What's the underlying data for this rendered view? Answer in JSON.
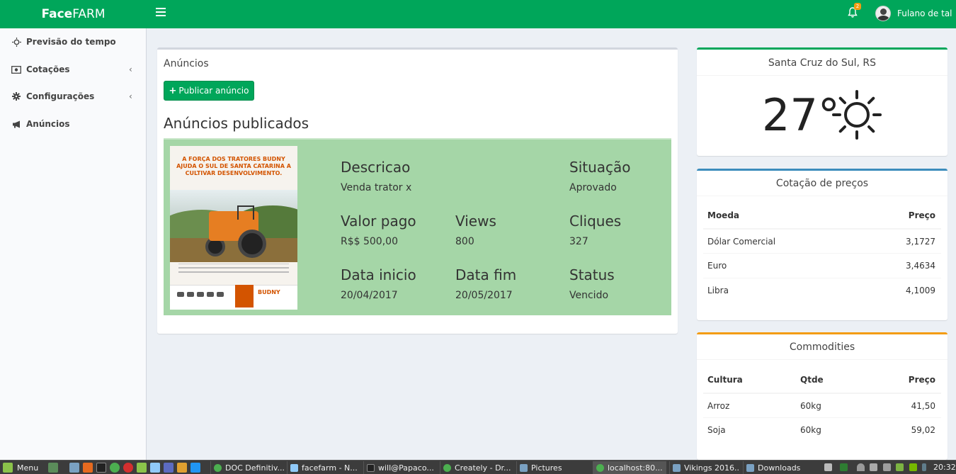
{
  "app": {
    "brand_bold": "Face",
    "brand_rest": "FARM"
  },
  "header": {
    "notification_count": "2",
    "user_name": "Fulano de tal"
  },
  "sidebar": {
    "items": [
      {
        "label": "Previsão do tempo",
        "icon": "sun-icon",
        "has_chevron": false
      },
      {
        "label": "Cotações",
        "icon": "money-icon",
        "has_chevron": true
      },
      {
        "label": "Configurações",
        "icon": "gear-icon",
        "has_chevron": true
      },
      {
        "label": "Anúncios",
        "icon": "bullhorn-icon",
        "has_chevron": false
      }
    ],
    "chevron_glyph": "‹"
  },
  "main": {
    "box_title": "Anúncios",
    "publish_button": "Publicar anúncio",
    "published_title": "Anúncios publicados",
    "ad": {
      "image_headline": "A FORÇA DOS TRATORES BUDNY AJUDA O SUL DE SANTA CATARINA A CULTIVAR DESENVOLVIMENTO.",
      "image_brand": "BUDNY",
      "fields": {
        "descricao": {
          "label": "Descricao",
          "value": "Venda trator x"
        },
        "situacao": {
          "label": "Situação",
          "value": "Aprovado"
        },
        "valor_pago": {
          "label": "Valor pago",
          "value": "R$$ 500,00"
        },
        "views": {
          "label": "Views",
          "value": "800"
        },
        "cliques": {
          "label": "Cliques",
          "value": "327"
        },
        "data_inicio": {
          "label": "Data inicio",
          "value": "20/04/2017"
        },
        "data_fim": {
          "label": "Data fim",
          "value": "20/05/2017"
        },
        "status": {
          "label": "Status",
          "value": "Vencido"
        }
      }
    }
  },
  "weather": {
    "city": "Santa Cruz do Sul, RS",
    "temperature": "27°",
    "icon": "sun-icon"
  },
  "rates": {
    "title": "Cotação de preços",
    "headers": [
      "Moeda",
      "Preço"
    ],
    "rows": [
      [
        "Dólar Comercial",
        "3,1727"
      ],
      [
        "Euro",
        "3,4634"
      ],
      [
        "Libra",
        "4,1009"
      ]
    ]
  },
  "commodities": {
    "title": "Commodities",
    "headers": [
      "Cultura",
      "Qtde",
      "Preço"
    ],
    "rows": [
      [
        "Arroz",
        "60kg",
        "41,50"
      ],
      [
        "Soja",
        "60kg",
        "59,02"
      ]
    ]
  },
  "taskbar": {
    "menu_label": "Menu",
    "windows": [
      "DOC Definitiv...",
      "facefarm - N...",
      "will@Papaco...",
      "Creately - Dr...",
      "Pictures",
      "localhost:80...",
      "Vikings 2016...",
      "Downloads"
    ],
    "clock": "20:32"
  },
  "colors": {
    "brand_green": "#00a65a",
    "ad_card_bg": "#a5d6a7",
    "rates_accent": "#3c8dbc",
    "commodities_accent": "#f39c12"
  }
}
